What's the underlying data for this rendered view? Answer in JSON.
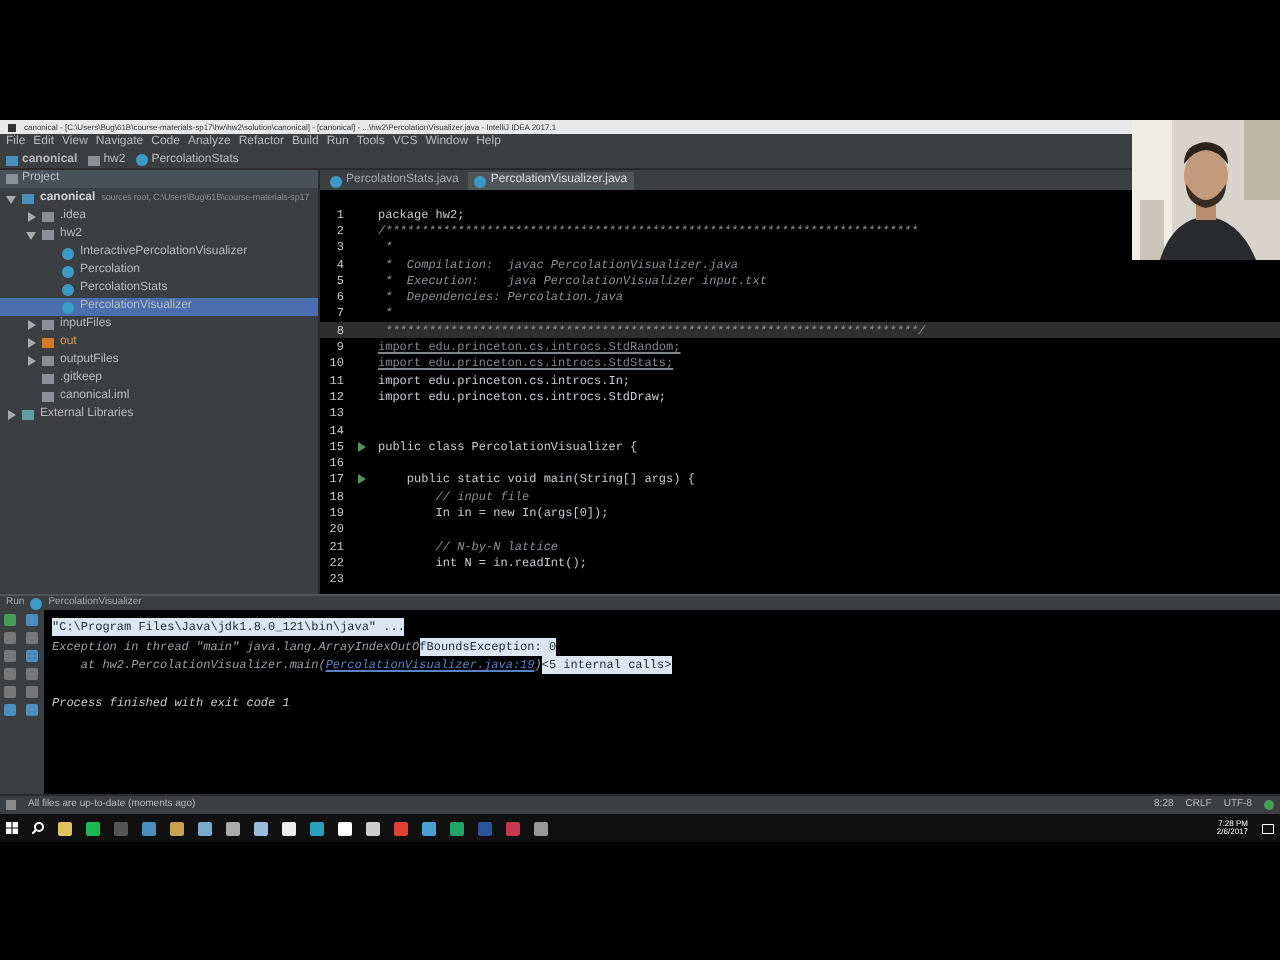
{
  "window": {
    "title": "canonical - [C:\\Users\\Bug\\61B\\course-materials-sp17\\hw\\hw2\\solution\\canonical] - [canonical] - ...\\hw2\\PercolationVisualizer.java - IntelliJ IDEA 2017.1"
  },
  "menu": [
    "File",
    "Edit",
    "View",
    "Navigate",
    "Code",
    "Analyze",
    "Refactor",
    "Build",
    "Run",
    "Tools",
    "VCS",
    "Window",
    "Help"
  ],
  "breadcrumbs": [
    {
      "label": "canonical",
      "kind": "module"
    },
    {
      "label": "hw2",
      "kind": "folder"
    },
    {
      "label": "PercolationStats",
      "kind": "class"
    }
  ],
  "project": {
    "title": "Project",
    "tree": [
      {
        "label": "canonical",
        "note": "sources root, C:\\Users\\Bug\\61B\\course-materials-sp17",
        "kind": "module",
        "expanded": true,
        "selected": false,
        "children": [
          {
            "label": ".idea",
            "kind": "folder",
            "expanded": false,
            "selected": false
          },
          {
            "label": "hw2",
            "kind": "folder",
            "expanded": true,
            "selected": false,
            "children": [
              {
                "label": "InteractivePercolationVisualizer",
                "kind": "class",
                "selected": false
              },
              {
                "label": "Percolation",
                "kind": "class",
                "selected": false
              },
              {
                "label": "PercolationStats",
                "kind": "class",
                "selected": false
              },
              {
                "label": "PercolationVisualizer",
                "kind": "class",
                "selected": true
              }
            ]
          },
          {
            "label": "inputFiles",
            "kind": "folder",
            "expanded": false,
            "selected": false
          },
          {
            "label": "out",
            "kind": "excluded",
            "expanded": false,
            "selected": false
          },
          {
            "label": "outputFiles",
            "kind": "folder",
            "expanded": false,
            "selected": false
          },
          {
            "label": ".gitkeep",
            "kind": "file",
            "selected": false
          },
          {
            "label": "canonical.iml",
            "kind": "file",
            "selected": false
          }
        ]
      },
      {
        "label": "External Libraries",
        "kind": "library",
        "expanded": false,
        "selected": false
      }
    ]
  },
  "tabs": [
    {
      "label": "PercolationStats.java",
      "selected": false
    },
    {
      "label": "PercolationVisualizer.java",
      "selected": true
    }
  ],
  "code": [
    {
      "num": "1",
      "text": "package hw2;",
      "kind": "code",
      "current": false
    },
    {
      "num": "2",
      "text": "/**************************************************************************",
      "kind": "comment",
      "current": false
    },
    {
      "num": "3",
      "text": " *",
      "kind": "comment",
      "current": false
    },
    {
      "num": "4",
      "text": " *  Compilation:  javac PercolationVisualizer.java",
      "kind": "comment",
      "current": false
    },
    {
      "num": "5",
      "text": " *  Execution:    java PercolationVisualizer input.txt",
      "kind": "comment",
      "current": false
    },
    {
      "num": "6",
      "text": " *  Dependencies: Percolation.java",
      "kind": "comment",
      "current": false
    },
    {
      "num": "7",
      "text": " *",
      "kind": "comment",
      "current": false
    },
    {
      "num": "8",
      "text": " **************************************************************************/",
      "kind": "comment",
      "current": true
    },
    {
      "num": "9",
      "text": "import edu.princeton.cs.introcs.StdRandom;",
      "kind": "unused",
      "current": false
    },
    {
      "num": "10",
      "text": "import edu.princeton.cs.introcs.StdStats;",
      "kind": "unused",
      "current": false
    },
    {
      "num": "11",
      "text": "import edu.princeton.cs.introcs.In;",
      "kind": "code",
      "current": false
    },
    {
      "num": "12",
      "text": "import edu.princeton.cs.introcs.StdDraw;",
      "kind": "code",
      "current": false
    },
    {
      "num": "13",
      "current": false
    },
    {
      "num": "14",
      "current": false
    },
    {
      "num": "15",
      "text": "public class PercolationVisualizer {",
      "kind": "code",
      "current": false,
      "run": true
    },
    {
      "num": "16",
      "current": false
    },
    {
      "num": "17",
      "text": "    public static void main(String[] args) {",
      "kind": "code",
      "current": false,
      "run": true
    },
    {
      "num": "18",
      "text": "        // input file",
      "kind": "comment",
      "current": false
    },
    {
      "num": "19",
      "text": "        In in = new In(args[0]);",
      "kind": "code",
      "current": false
    },
    {
      "num": "20",
      "current": false
    },
    {
      "num": "21",
      "text": "        // N-by-N lattice",
      "kind": "comment",
      "current": false
    },
    {
      "num": "22",
      "text": "        int N = in.readInt();",
      "kind": "code",
      "current": false
    },
    {
      "num": "23",
      "current": false
    }
  ],
  "run": {
    "title": "Run",
    "config": "PercolationVisualizer",
    "console": [
      {
        "kind": "command",
        "parts": [
          {
            "text": "\"C:\\Program Files\\Java\\jdk1.8.0_121\\bin\\java\" ...",
            "kind": "highlight"
          }
        ]
      },
      {
        "kind": "error",
        "parts": [
          {
            "text": "Exception in thread \"main\" java.lang.ArrayIndexOutO",
            "kind": "plain"
          },
          {
            "text": "fBoundsException: 0",
            "kind": "highlight"
          }
        ]
      },
      {
        "kind": "error",
        "parts": [
          {
            "text": "    at hw2.PercolationVisualizer.main(",
            "kind": "plain"
          },
          {
            "text": "PercolationVisualizer.java:19",
            "kind": "link"
          },
          {
            "text": ")",
            "kind": "plain"
          },
          {
            "text": "<5 internal calls>",
            "kind": "highlight"
          }
        ]
      },
      {
        "kind": "output",
        "parts": [
          {
            "text": "Process finished with exit code 1",
            "kind": "plain"
          }
        ]
      }
    ]
  },
  "status_bar": {
    "message": "All files are up-to-date (moments ago)",
    "position": "8:28",
    "line_ending": "CRLF",
    "encoding": "UTF-8"
  },
  "taskbar": {
    "time": "7:28 PM",
    "date": "2/6/2017"
  }
}
